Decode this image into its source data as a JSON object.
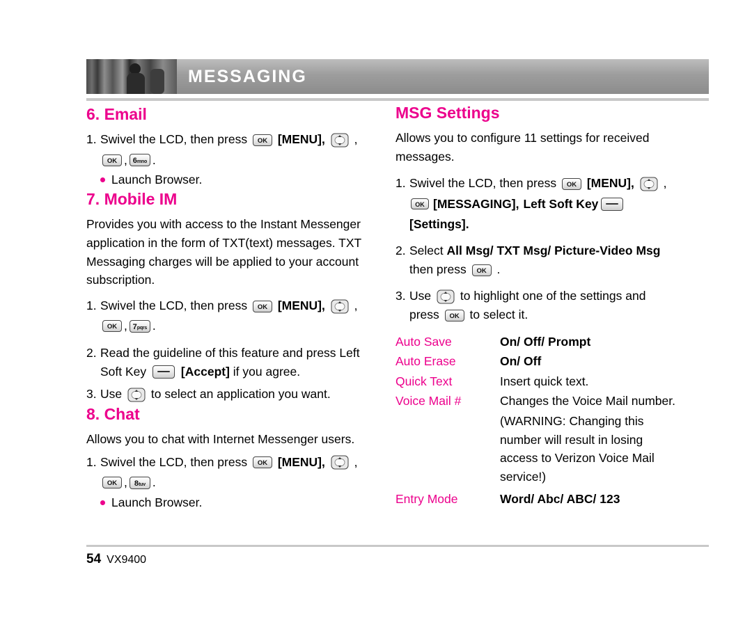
{
  "header": {
    "title": "MESSAGING"
  },
  "left": {
    "email": {
      "heading": "6. Email",
      "step1": {
        "num": "1.",
        "text_a": "Swivel the LCD, then press",
        "key_ok": "OK",
        "text_b": "[MENU],",
        "comma": ",",
        "key_ok2": "OK",
        "key_num": "6",
        "key_num_letters": "mno",
        "period": "."
      },
      "bullet": "Launch Browser."
    },
    "mobile_im": {
      "heading": "7. Mobile IM",
      "paragraph": "Provides you with access to the Instant Messenger application in the form of TXT(text) messages. TXT Messaging charges will be applied to your account subscription.",
      "step1": {
        "num": "1.",
        "text_a": "Swivel the LCD, then press",
        "key_ok": "OK",
        "text_b": "[MENU],",
        "key_ok2": "OK",
        "key_num": "7",
        "key_num_letters": "pqrs",
        "period": "."
      },
      "step2": {
        "num": "2.",
        "text_a": "Read the guideline of this feature and press Left",
        "text_b": "Soft Key",
        "text_c": "[Accept]",
        "text_d": "if you agree."
      },
      "step3": {
        "num": "3.",
        "text_a": "Use",
        "text_b": "to select an application you want."
      }
    },
    "chat": {
      "heading": "8. Chat",
      "paragraph": "Allows you to chat with Internet Messenger users.",
      "step1": {
        "num": "1.",
        "text_a": "Swivel the LCD, then press",
        "key_ok": "OK",
        "text_b": "[MENU],",
        "key_ok2": "OK",
        "key_num": "8",
        "key_num_letters": "tuv",
        "period": "."
      },
      "bullet": "Launch Browser."
    }
  },
  "right": {
    "msg_settings": {
      "heading": "MSG Settings",
      "paragraph": "Allows you to configure 11 settings for received messages.",
      "step1": {
        "num": "1.",
        "text_a": "Swivel the LCD, then press",
        "key_ok": "OK",
        "text_b": "[MENU],",
        "comma": ",",
        "key_ok2": "OK",
        "text_c": "[MESSAGING],",
        "text_d": "Left Soft Key",
        "text_e": "[Settings]."
      },
      "step2": {
        "num": "2.",
        "text_a": "Select",
        "text_b": "All Msg/ TXT Msg/ Picture-Video Msg",
        "text_c": "then press",
        "key_ok": "OK",
        "period": "."
      },
      "step3": {
        "num": "3.",
        "text_a": "Use",
        "text_b": "to highlight one of the settings and",
        "text_c": "press",
        "key_ok": "OK",
        "text_d": "to select it."
      },
      "settings": [
        {
          "name": "Auto Save",
          "value": "On/ Off/ Prompt",
          "bold": true
        },
        {
          "name": "Auto Erase",
          "value": "On/ Off",
          "bold": true
        },
        {
          "name": "Quick Text",
          "value": "Insert quick text.",
          "bold": false
        },
        {
          "name": "Voice Mail #",
          "value": "Changes the Voice Mail number.",
          "bold": false
        },
        {
          "name": "Entry Mode",
          "value": "Word/ Abc/ ABC/ 123",
          "bold": true
        }
      ],
      "voice_mail_continuation": [
        "(WARNING: Changing this",
        "number will result in losing",
        "access to Verizon Voice Mail",
        "service!)"
      ]
    }
  },
  "footer": {
    "page": "54",
    "model": "VX9400"
  },
  "colors": {
    "accent": "#ec008c",
    "header_bg": "#9a9a9a",
    "rule": "#c8c8c8"
  }
}
